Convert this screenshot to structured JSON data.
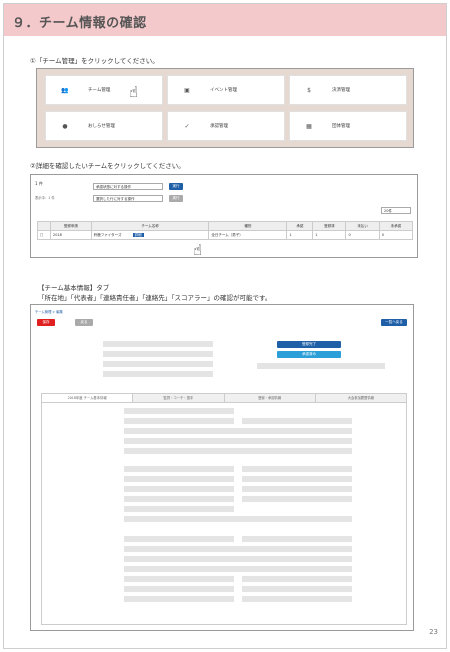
{
  "header": {
    "title": "９．チーム情報の確認"
  },
  "step1": {
    "instruction": "①「チーム管理」をクリックしてください。",
    "tiles": [
      {
        "label": "チーム管理",
        "icon": "people-icon"
      },
      {
        "label": "イベント管理",
        "icon": "calendar-icon"
      },
      {
        "label": "決済管理",
        "icon": "dollar-icon"
      },
      {
        "label": "おしらせ管理",
        "icon": "bell-icon"
      },
      {
        "label": "承認管理",
        "icon": "check-icon"
      },
      {
        "label": "団体管理",
        "icon": "building-icon"
      }
    ]
  },
  "step2": {
    "instruction": "②詳細を確認したいチームをクリックしてください。",
    "count": "1 件",
    "display": "表示中：1 件",
    "filter1": "承認状態に対する操作",
    "filter2": "選択した行に対する操作",
    "btn1": "実行",
    "btn2": "実行",
    "page_size": "20件",
    "columns": [
      "",
      "登録申請",
      "チーム名称",
      "種別",
      "承認",
      "登録済",
      "未払い",
      "未承認"
    ],
    "row": [
      "",
      "2018",
      "鈴鹿ファイターズ",
      "全日チーム（男子）",
      "1",
      "1",
      "0",
      "0"
    ],
    "detail_btn": "詳細"
  },
  "tab": {
    "title": "【チーム基本情報】タブ",
    "desc": "「所在地」「代表者」「連絡責任者」「連絡先」「スコアラー」の確認が可能です。",
    "breadcrumb": "チーム管理 > 編集",
    "save_btn": "保存",
    "back_btn": "戻る",
    "right_btn": "一覧へ戻る",
    "status_btn": "登録完了",
    "apply_btn": "承認済み",
    "subtabs": [
      "2018年度 チーム基本情報",
      "監督・コーチ・選手",
      "登録・承認情報",
      "大会参加履歴情報"
    ]
  },
  "page_number": "23",
  "colors": {
    "header_bg": "#f4c9cc",
    "primary": "#1f5fa8",
    "danger": "#e02020",
    "cyan": "#2a9fd8"
  }
}
